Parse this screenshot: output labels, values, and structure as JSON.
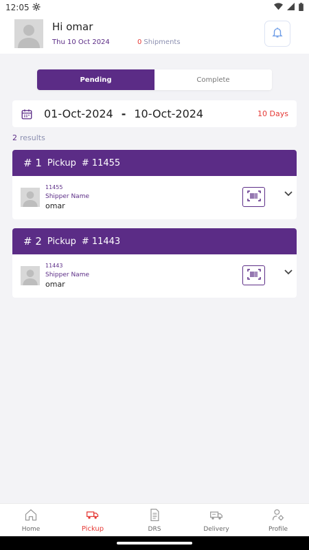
{
  "status_bar": {
    "time": "12:05"
  },
  "header": {
    "greeting": "Hi omar",
    "date": "Thu 10 Oct 2024",
    "shipments_count": "0",
    "shipments_label": "Shipments"
  },
  "tabs": {
    "pending": "Pending",
    "complete": "Complete"
  },
  "date_range": {
    "from": "01-Oct-2024",
    "separator": "-",
    "to": "10-Oct-2024",
    "days": "10 Days"
  },
  "results": {
    "count": "2",
    "label": "results"
  },
  "pickups": [
    {
      "index": "# 1",
      "type": "Pickup",
      "number": "# 11455",
      "id": "11455",
      "label": "Shipper Name",
      "name": "omar"
    },
    {
      "index": "# 2",
      "type": "Pickup",
      "number": "# 11443",
      "id": "11443",
      "label": "Shipper Name",
      "name": "omar"
    }
  ],
  "nav": {
    "home": "Home",
    "pickup": "Pickup",
    "drs": "DRS",
    "delivery": "Delivery",
    "profile": "Profile"
  },
  "colors": {
    "primary": "#5b2c86",
    "accent": "#e53935",
    "background": "#f3f3f6"
  },
  "icons": [
    "settings-icon",
    "wifi-icon",
    "signal-icon",
    "battery-icon",
    "bell-icon",
    "calendar-icon",
    "barcode-scan-icon",
    "chevron-down-icon",
    "home-icon",
    "truck-icon",
    "document-icon",
    "delivery-van-icon",
    "profile-settings-icon"
  ]
}
